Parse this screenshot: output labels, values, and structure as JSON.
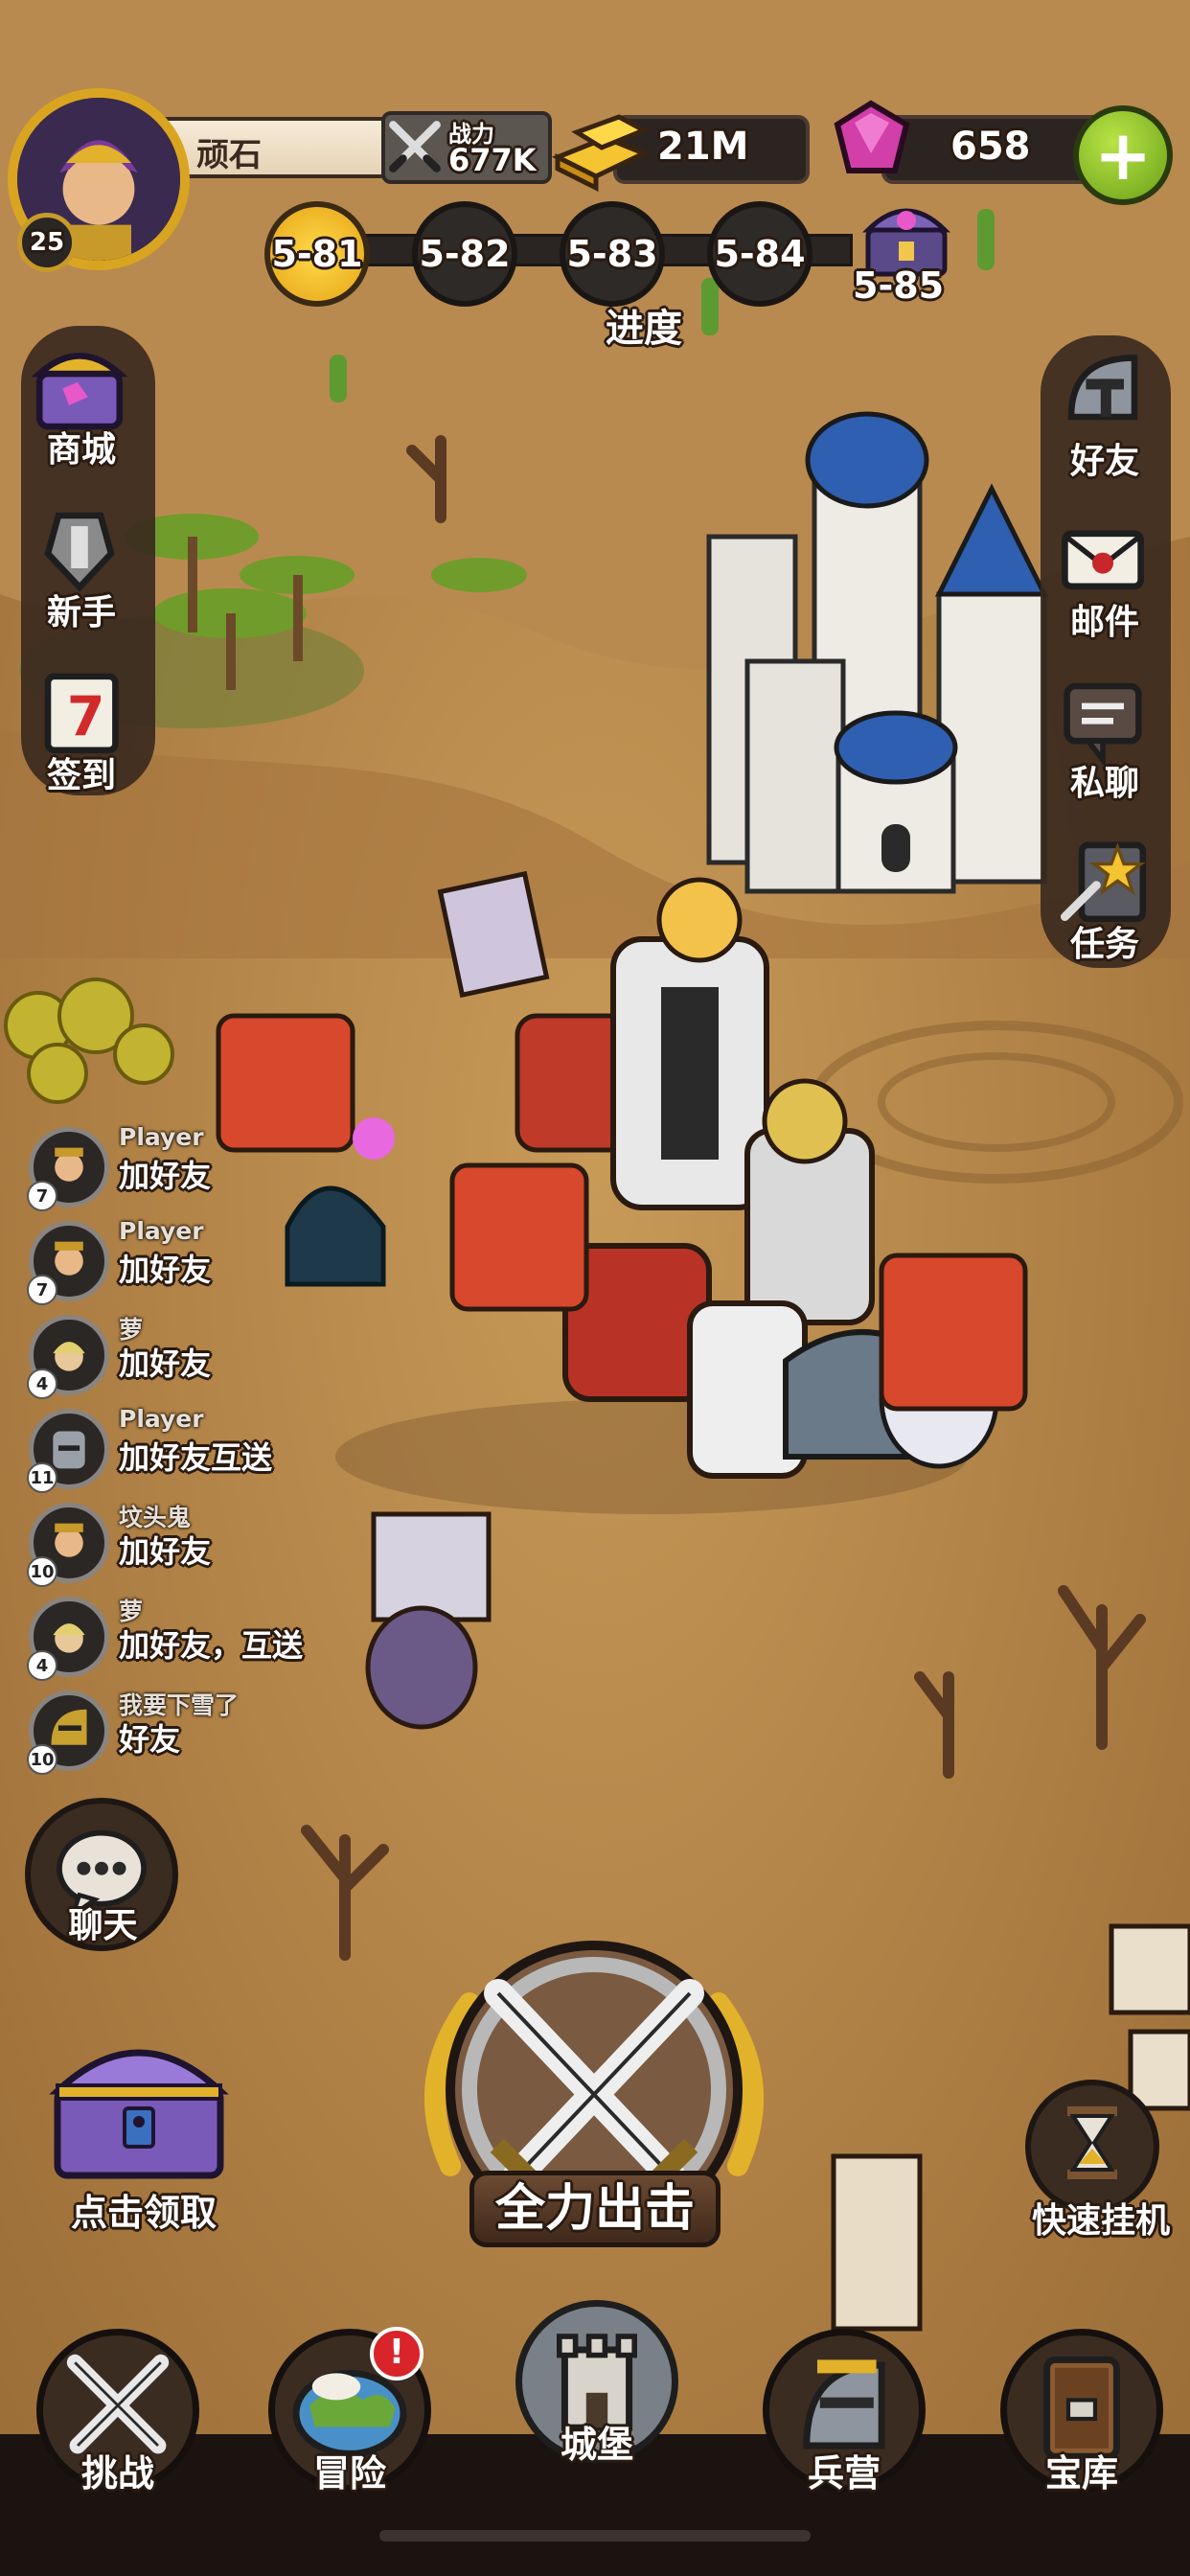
{
  "player": {
    "name": "顽石",
    "level": "25",
    "power_label": "战力",
    "power_value": "677K"
  },
  "resources": {
    "gold": "21M",
    "gems": "658",
    "add_label": "+"
  },
  "stages": {
    "nodes": [
      {
        "label": "5-81",
        "state": "current"
      },
      {
        "label": "5-82",
        "state": "locked"
      },
      {
        "label": "5-83",
        "state": "locked"
      },
      {
        "label": "5-84",
        "state": "locked"
      }
    ],
    "chest_label": "5-85",
    "progress_label": "进度",
    "progress": 0.08
  },
  "left_menu": [
    {
      "label": "商城",
      "icon": "shop-chest-icon"
    },
    {
      "label": "新手",
      "icon": "novice-sword-icon"
    },
    {
      "label": "签到",
      "icon": "checkin-calendar-icon"
    }
  ],
  "right_menu": [
    {
      "label": "好友",
      "icon": "friends-helmet-icon"
    },
    {
      "label": "邮件",
      "icon": "mail-envelope-icon"
    },
    {
      "label": "私聊",
      "icon": "private-chat-icon"
    },
    {
      "label": "任务",
      "icon": "quest-star-icon"
    }
  ],
  "chat": [
    {
      "name": "Player",
      "message": "加好友",
      "level": "7"
    },
    {
      "name": "Player",
      "message": "加好友",
      "level": "7"
    },
    {
      "name": "萝",
      "message": "加好友",
      "level": "4"
    },
    {
      "name": "Player",
      "message": "加好友互送",
      "level": "11"
    },
    {
      "name": "坟头鬼",
      "message": "加好友",
      "level": "10"
    },
    {
      "name": "萝",
      "message": "加好友，互送",
      "level": "4"
    },
    {
      "name": "我要下雪了",
      "message": "好友",
      "level": "10"
    }
  ],
  "actions": {
    "chat_label": "聊天",
    "claim_label": "点击领取",
    "attack_label": "全力出击",
    "quick_idle_label": "快速挂机"
  },
  "bottom_nav": [
    {
      "label": "挑战",
      "icon": "challenge-swords-icon"
    },
    {
      "label": "冒险",
      "icon": "adventure-map-icon",
      "alert": "!"
    },
    {
      "label": "城堡",
      "icon": "castle-icon"
    },
    {
      "label": "兵营",
      "icon": "barracks-helmet-icon"
    },
    {
      "label": "宝库",
      "icon": "treasury-door-icon"
    }
  ],
  "colors": {
    "gold": "#f4c431",
    "gem": "#d23fa9",
    "accent_green": "#8cc427",
    "alert_red": "#d8242a"
  }
}
